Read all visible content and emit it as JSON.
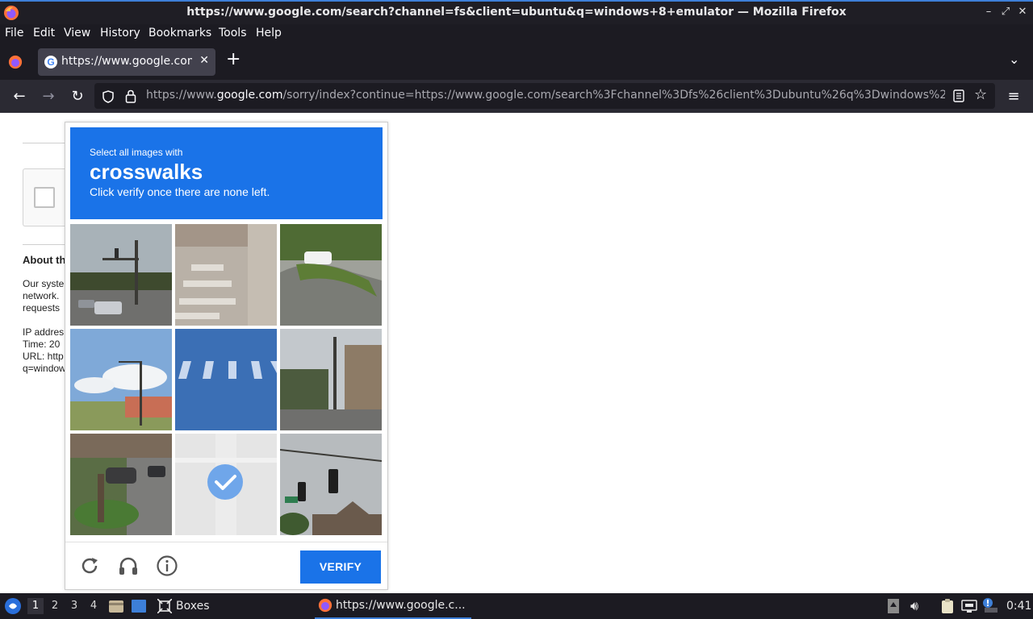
{
  "window": {
    "title": "https://www.google.com/search?channel=fs&client=ubuntu&q=windows+8+emulator — Mozilla Firefox",
    "controls": [
      "minimize",
      "maximize",
      "close"
    ]
  },
  "menu": [
    "File",
    "Edit",
    "View",
    "History",
    "Bookmarks",
    "Tools",
    "Help"
  ],
  "tab": {
    "title": "https://www.google.com/sorry/index?continue=",
    "favicon": "G"
  },
  "urlbar": {
    "prefix": "https://www.",
    "host": "google.com",
    "rest": "/sorry/index?continue=https://www.google.com/search%3Fchannel%3Dfs%26client%3Dubuntu%26q%3Dwindows%2"
  },
  "page": {
    "heading": "About th",
    "body_lines": [
      "Our syste",
      "network.",
      "requests"
    ],
    "ip_line": "IP addres",
    "time_line": "Time: 20",
    "url_line": "URL: http",
    "q_line": "q=window"
  },
  "captcha": {
    "instruction": "Select all images with",
    "target": "crosswalks",
    "hint": "Click verify once there are none left.",
    "verify_label": "VERIFY",
    "tiles": [
      {
        "desc": "traffic-light-intersection",
        "selected": false
      },
      {
        "desc": "crosswalk-stripes",
        "selected": false
      },
      {
        "desc": "trees-white-car",
        "selected": false
      },
      {
        "desc": "street-lamp-building",
        "selected": false
      },
      {
        "desc": "blue-crosswalk",
        "selected": false
      },
      {
        "desc": "street-buildings",
        "selected": false
      },
      {
        "desc": "parked-cars-trees",
        "selected": false
      },
      {
        "desc": "faded-road",
        "selected": true
      },
      {
        "desc": "traffic-signal-sky",
        "selected": false
      }
    ],
    "accent": "#1a73e8"
  },
  "taskbar": {
    "workspaces": [
      "1",
      "2",
      "3",
      "4"
    ],
    "active_workspace": "1",
    "boxes_label": "Boxes",
    "task_title": "https://www.google.c...",
    "clock": "0:41"
  }
}
